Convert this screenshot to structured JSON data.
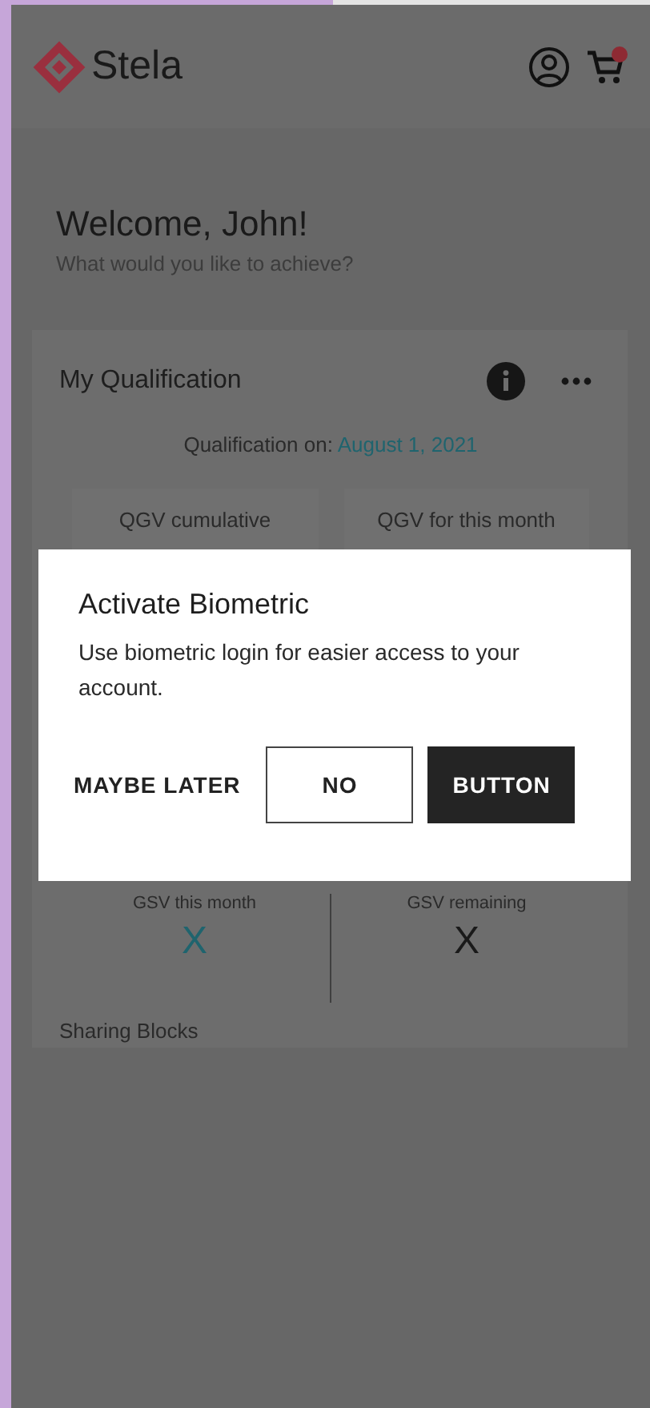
{
  "header": {
    "logo_text": "Stela"
  },
  "welcome": {
    "title": "Welcome, John!",
    "subtitle": "What would you like to achieve?"
  },
  "qualification_card": {
    "title": "My Qualification",
    "date_label": "Qualification on:",
    "date": "August 1, 2021",
    "top_stats": [
      {
        "label": "QGV cumulative"
      },
      {
        "label": "QGV for this month"
      }
    ],
    "bottom_stats": [
      {
        "label": "GSV this month",
        "value": "X",
        "highlight": true
      },
      {
        "label": "GSV remaining",
        "value": "X",
        "highlight": false
      }
    ],
    "section_title": "Sharing Blocks"
  },
  "dialog": {
    "title": "Activate Biometric",
    "message": "Use biometric login for easier access to your account.",
    "buttons": [
      {
        "label": "MAYBE LATER",
        "kind": "text"
      },
      {
        "label": "NO",
        "kind": "outlined"
      },
      {
        "label": "BUTTON",
        "kind": "filled"
      }
    ]
  }
}
